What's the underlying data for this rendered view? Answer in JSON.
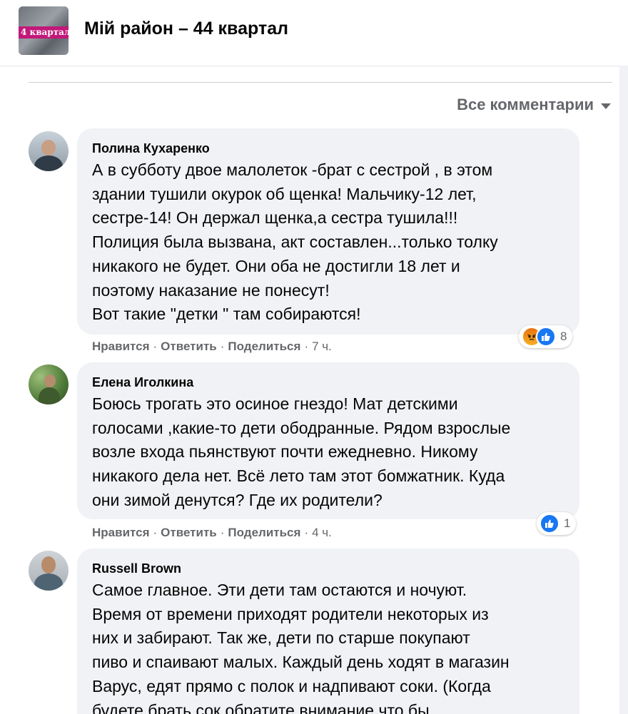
{
  "header": {
    "group_name": "Мій район – 44 квартал",
    "thumbnail_text": "4 квартал"
  },
  "filter": {
    "label": "Все комментарии"
  },
  "actions": {
    "like": "Нравится",
    "reply": "Ответить",
    "share": "Поделиться",
    "separator": "·"
  },
  "comments": [
    {
      "author": "Полина Кухаренко",
      "lines": [
        "А в субботу двое малолеток -брат с сестрой , в этом",
        "здании тушили окурок об щенка! Мальчику-12 лет,",
        "сестре-14! Он держал щенка,а сестра тушила!!!",
        "Полиция была вызвана, акт составлен...только толку",
        "никакого не будет. Они оба не достигли 18 лет и",
        "поэтому наказание не понесут!",
        "Вот такие \"детки \" там собираются!"
      ],
      "time": "7 ч.",
      "reaction_count": "8",
      "reaction_icons": [
        "angry-icon",
        "like-icon"
      ]
    },
    {
      "author": "Елена Иголкина",
      "lines": [
        "Боюсь трогать это осиное гнездо! Мат детскими",
        "голосами ,какие-то дети ободранные. Рядом взрослые",
        "возле входа пьянствуют почти ежедневно. Никому",
        "никакого дела нет. Всё лето там этот бомжатник. Куда",
        "они зимой денутся? Где их родители?"
      ],
      "time": "4 ч.",
      "reaction_count": "1",
      "reaction_icons": [
        "like-icon"
      ]
    },
    {
      "author": "Russell Brown",
      "lines": [
        "Самое главное. Эти дети там остаются и ночуют.",
        "Время от времени приходят родители некоторых из",
        "них и забирают. Так же, дети по старше покупают",
        "пиво и спаивают малых. Каждый день ходят в магазин",
        "Варус, едят прямо с полок и надпивают соки. (Когда",
        "будете брать сок обратите внимание что бы"
      ]
    }
  ],
  "colors": {
    "bubble_bg": "#f0f2f5",
    "secondary_text": "#65676b",
    "like_blue": "#1877f2",
    "angry_orange": "#e9710f"
  }
}
